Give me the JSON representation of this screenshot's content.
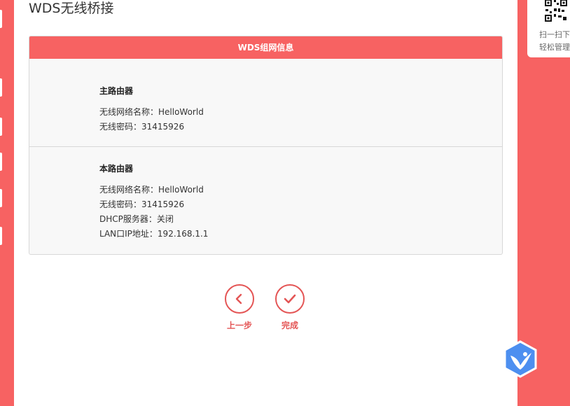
{
  "page": {
    "title": "WDS无线桥接"
  },
  "panel": {
    "header": "WDS组网信息",
    "main_router": {
      "title": "主路由器",
      "ssid": "无线网络名称：HelloWorld",
      "password": "无线密码：31415926"
    },
    "this_router": {
      "title": "本路由器",
      "ssid": "无线网络名称：HelloWorld",
      "password": "无线密码：31415926",
      "dhcp": "DHCP服务器：关闭",
      "lan_ip": "LAN口IP地址：192.168.1.1"
    }
  },
  "actions": {
    "prev": "上一步",
    "finish": "完成"
  },
  "qr": {
    "line1": "扫一扫下",
    "line2": "轻松管理"
  },
  "icons": {
    "prev": "chevron-left-icon",
    "finish": "check-icon",
    "assistant": "bird-icon",
    "qr": "qr-code-icon"
  },
  "colors": {
    "accent": "#f76262",
    "button": "#e45555"
  }
}
